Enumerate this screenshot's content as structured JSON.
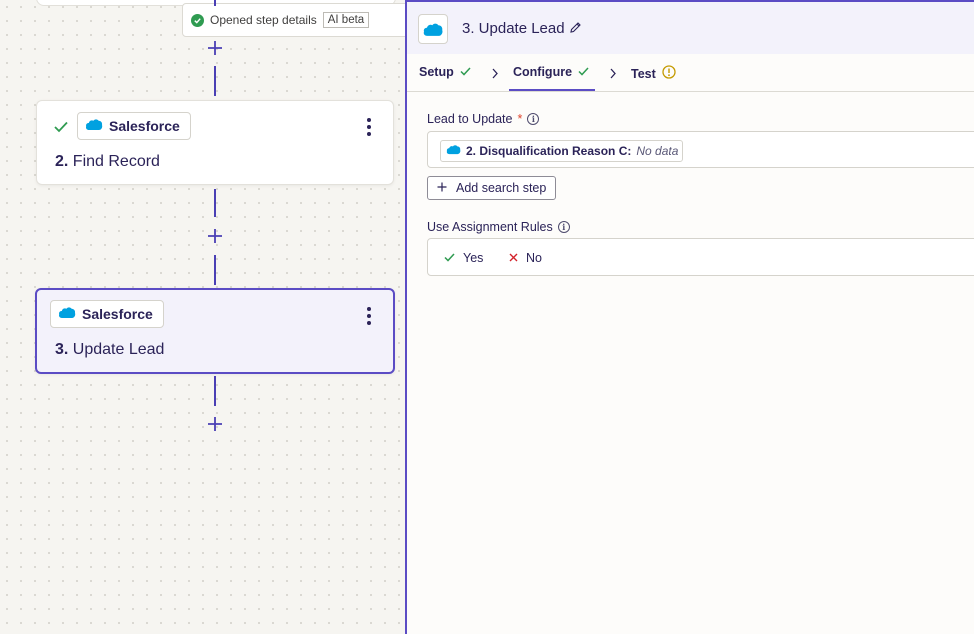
{
  "toast": {
    "text": "Opened step details",
    "badge": "AI beta"
  },
  "canvas": {
    "steps": [
      {
        "number": "2.",
        "title": "Find Record",
        "app": "Salesforce",
        "status": "complete"
      },
      {
        "number": "3.",
        "title": "Update Lead",
        "app": "Salesforce",
        "status": "selected"
      }
    ]
  },
  "panel": {
    "header": {
      "title": "3. Update Lead"
    },
    "tabs": [
      {
        "label": "Setup",
        "status": "complete"
      },
      {
        "label": "Configure",
        "status": "complete"
      },
      {
        "label": "Test",
        "status": "warning"
      }
    ],
    "fields": {
      "lead": {
        "label": "Lead to Update",
        "required_mark": "*",
        "pill_label": "2. Disqualification Reason C:",
        "pill_value": "No data"
      },
      "add_search_step": "Add search step",
      "assignment": {
        "label": "Use Assignment Rules",
        "options": [
          "Yes",
          "No"
        ]
      }
    }
  },
  "colors": {
    "accent": "#5b4cc4",
    "success": "#2f9b51",
    "error": "#d3222a",
    "warning": "#c49a00",
    "salesforce": "#00a1e0"
  }
}
